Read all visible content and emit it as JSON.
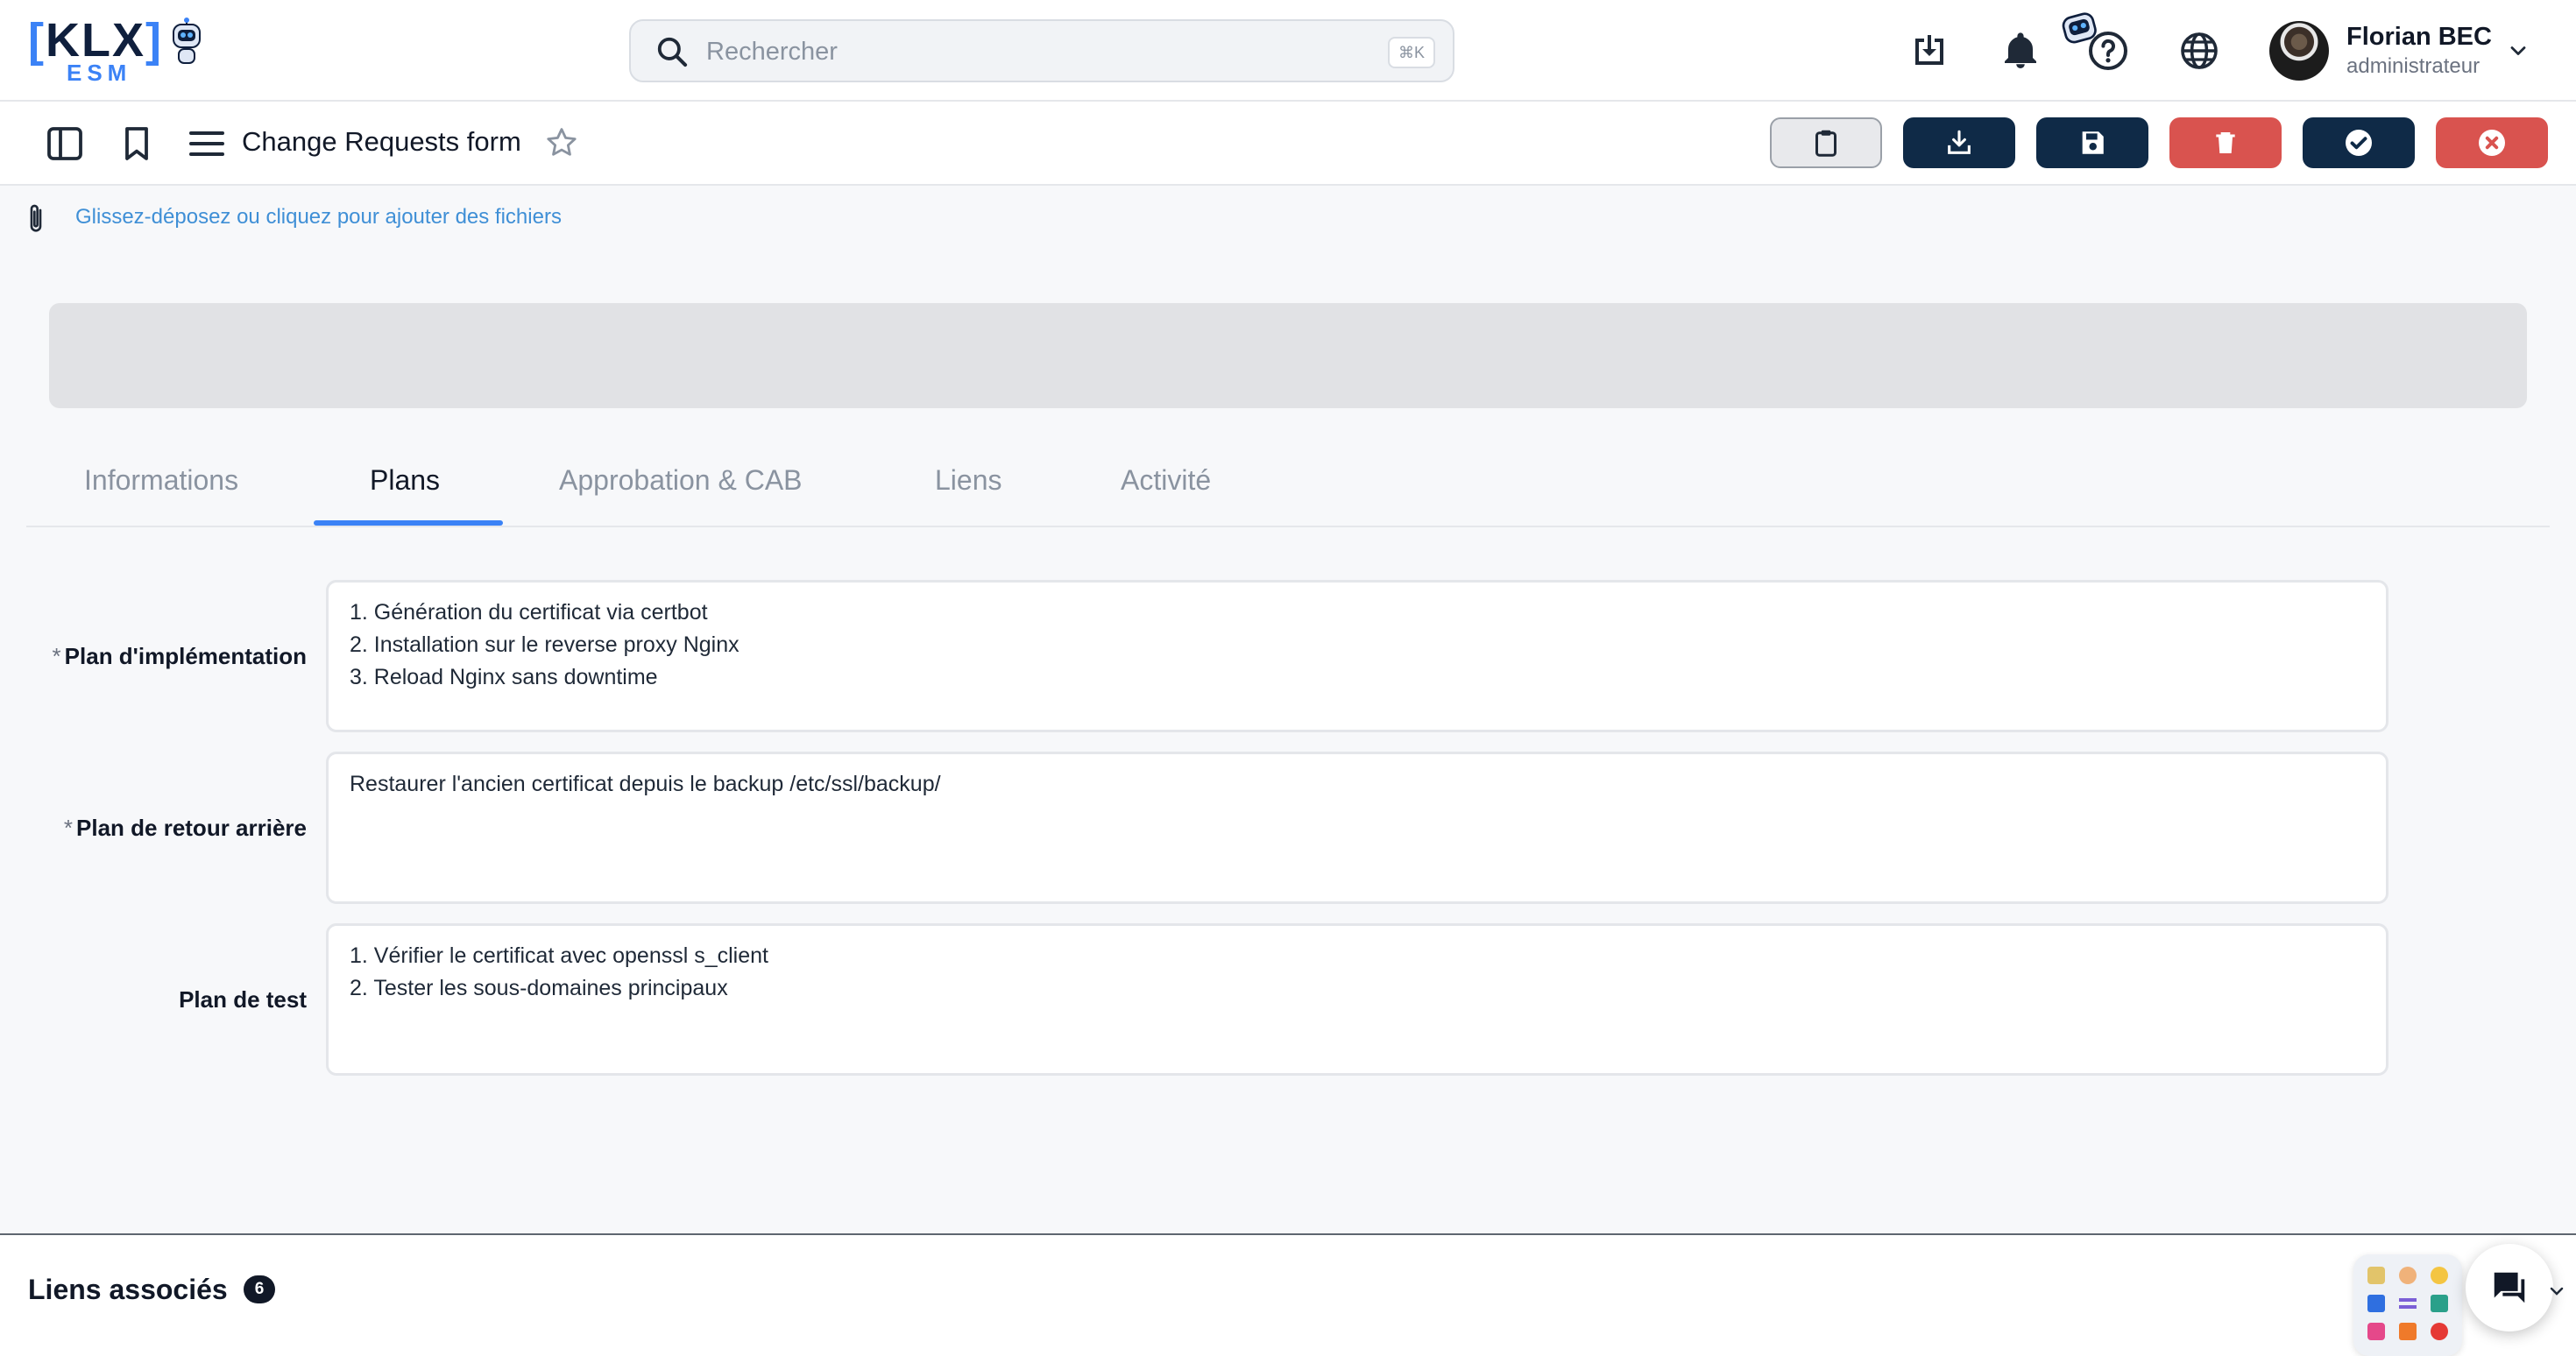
{
  "brand": {
    "logo_bracket_open": "[",
    "logo_text": "KLX",
    "logo_bracket_close": "]",
    "logo_sub": "ESM",
    "accent": "#3b82f6",
    "navy": "#0f2a47",
    "danger": "#d9534f"
  },
  "header": {
    "search": {
      "placeholder": "Rechercher",
      "shortcut": "⌘K"
    },
    "icons": [
      "download-tray-icon",
      "bell-icon",
      "robot-assistant-icon",
      "help-icon",
      "globe-icon"
    ],
    "user": {
      "name": "Florian BEC",
      "role": "administrateur"
    }
  },
  "toolbar": {
    "title": "Change Requests form",
    "actions": [
      "clipboard",
      "download",
      "save",
      "delete",
      "validate",
      "cancel"
    ]
  },
  "attachments": {
    "label": "Glissez-déposez ou cliquez pour ajouter des fichiers"
  },
  "tabs": [
    {
      "label": "Informations",
      "active": false
    },
    {
      "label": "Plans",
      "active": true
    },
    {
      "label": "Approbation & CAB",
      "active": false
    },
    {
      "label": "Liens",
      "active": false
    },
    {
      "label": "Activité",
      "active": false
    }
  ],
  "fields": [
    {
      "label": "Plan d'implémentation",
      "required": "*",
      "lines": [
        "1. Génération du certificat via certbot",
        "2. Installation sur le reverse proxy Nginx",
        "3. Reload Nginx sans downtime"
      ]
    },
    {
      "label": "Plan de retour arrière",
      "required": "*",
      "lines": [
        "Restaurer l'ancien certificat depuis le backup /etc/ssl/backup/"
      ]
    },
    {
      "label": "Plan de test",
      "required": "",
      "lines": [
        "1. Vérifier le certificat avec openssl s_client",
        "2. Tester les sous-domaines principaux"
      ]
    }
  ],
  "footer": {
    "title": "Liens associés",
    "count": "6"
  }
}
